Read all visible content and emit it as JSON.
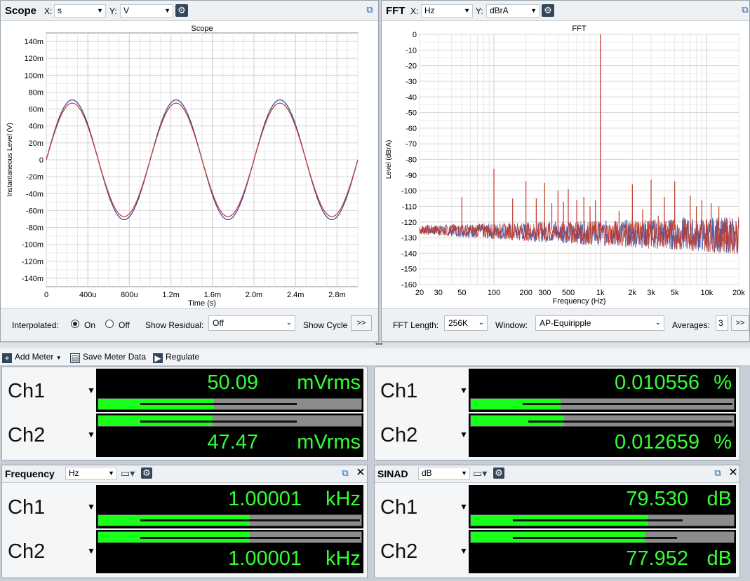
{
  "scope": {
    "title": "Scope",
    "x_label": "X:",
    "x_unit": "s",
    "y_label": "Y:",
    "y_unit": "V",
    "chart_title": "Scope",
    "interpolated_label": "Interpolated:",
    "on_label": "On",
    "off_label": "Off",
    "show_residual_label": "Show Residual:",
    "show_residual_value": "Off",
    "show_cycle_label": "Show Cycle",
    "more_label": ">>"
  },
  "fft": {
    "title": "FFT",
    "x_label": "X:",
    "x_unit": "Hz",
    "y_label": "Y:",
    "y_unit": "dBrA",
    "chart_title": "FFT",
    "fft_length_label": "FFT Length:",
    "fft_length_value": "256K",
    "window_label": "Window:",
    "window_value": "AP-Equiripple",
    "averages_label": "Averages:",
    "averages_value": "3",
    "more_label": ">>"
  },
  "toolbar": {
    "add_meter": "Add Meter",
    "save_meter_data": "Save Meter Data",
    "regulate": "Regulate"
  },
  "meters": {
    "level": {
      "ch1": {
        "label": "Ch1",
        "value": "50.09",
        "unit": "mVrms",
        "bar": 0.44,
        "peak": 0.76
      },
      "ch2": {
        "label": "Ch2",
        "value": "47.47",
        "unit": "mVrms",
        "bar": 0.435,
        "peak": 0.76
      }
    },
    "thdn": {
      "ch1": {
        "label": "Ch1",
        "value": "0.010556",
        "unit": "%",
        "bar": 0.34,
        "peak": 1.0
      },
      "ch2": {
        "label": "Ch2",
        "value": "0.012659",
        "unit": "%",
        "bar": 0.355,
        "peak": 1.0
      }
    },
    "frequency": {
      "title": "Frequency",
      "unit_select": "Hz",
      "ch1": {
        "label": "Ch1",
        "value": "1.00001",
        "unit": "kHz",
        "bar": 0.575,
        "peak": 1.0
      },
      "ch2": {
        "label": "Ch2",
        "value": "1.00001",
        "unit": "kHz",
        "bar": 0.575,
        "peak": 1.0
      }
    },
    "sinad": {
      "title": "SINAD",
      "unit_select": "dB",
      "ch1": {
        "label": "Ch1",
        "value": "79.530",
        "unit": "dB",
        "bar": 0.675,
        "peak": 0.81
      },
      "ch2": {
        "label": "Ch2",
        "value": "77.952",
        "unit": "dB",
        "bar": 0.66,
        "peak": 0.79
      }
    }
  },
  "colors": {
    "ch1": "#2c3e9b",
    "ch2": "#c0392b",
    "meter_green": "#33ff33"
  },
  "chart_data": [
    {
      "type": "line",
      "title": "Scope",
      "xlabel": "Time (s)",
      "ylabel": "Instantaneous Level (V)",
      "xlim": [
        0,
        0.003
      ],
      "ylim": [
        -0.15,
        0.15
      ],
      "x_ticks": [
        0,
        0.0004,
        0.0008,
        0.0012,
        0.0016,
        0.002,
        0.0024,
        0.0028
      ],
      "x_tick_labels": [
        "0",
        "400u",
        "800u",
        "1.2m",
        "1.6m",
        "2.0m",
        "2.4m",
        "2.8m"
      ],
      "y_ticks": [
        0.14,
        0.12,
        0.1,
        0.08,
        0.06,
        0.04,
        0.02,
        0,
        -0.02,
        -0.04,
        -0.06,
        -0.08,
        -0.1,
        -0.12,
        -0.14
      ],
      "y_tick_labels": [
        "140m",
        "120m",
        "100m",
        "80m",
        "60m",
        "40m",
        "20m",
        "0",
        "-20m",
        "-40m",
        "-60m",
        "-80m",
        "-100m",
        "-120m",
        "-140m"
      ],
      "series": [
        {
          "frequency_hz": 1000,
          "amplitude_v": 0.0708,
          "color": "#2c3e9b"
        },
        {
          "frequency_hz": 1000,
          "amplitude_v": 0.0671,
          "color": "#c0392b"
        }
      ],
      "grid": true
    },
    {
      "type": "line",
      "title": "FFT",
      "xlabel": "Frequency (Hz)",
      "ylabel": "Level (dBrA)",
      "xscale": "log",
      "xlim": [
        20,
        20000
      ],
      "ylim": [
        -160,
        0
      ],
      "x_ticks": [
        20,
        30,
        50,
        100,
        200,
        300,
        500,
        1000,
        2000,
        3000,
        5000,
        10000,
        20000
      ],
      "x_tick_labels": [
        "20",
        "30",
        "50",
        "100",
        "200",
        "300",
        "500",
        "1k",
        "2k",
        "3k",
        "5k",
        "10k",
        "20k"
      ],
      "y_ticks": [
        0,
        -10,
        -20,
        -30,
        -40,
        -50,
        -60,
        -70,
        -80,
        -90,
        -100,
        -110,
        -120,
        -130,
        -140,
        -150,
        -160
      ],
      "y_tick_labels": [
        "0",
        "-10",
        "-20",
        "-30",
        "-40",
        "-50",
        "-60",
        "-70",
        "-80",
        "-90",
        "-100",
        "-110",
        "-120",
        "-130",
        "-140",
        "-150",
        "-160"
      ],
      "noise_floor_db": -125,
      "peaks": [
        {
          "x": 50,
          "y": -104
        },
        {
          "x": 100,
          "y": -86
        },
        {
          "x": 150,
          "y": -105
        },
        {
          "x": 200,
          "y": -94
        },
        {
          "x": 250,
          "y": -105
        },
        {
          "x": 300,
          "y": -95
        },
        {
          "x": 350,
          "y": -108
        },
        {
          "x": 400,
          "y": -100
        },
        {
          "x": 450,
          "y": -107
        },
        {
          "x": 500,
          "y": -99
        },
        {
          "x": 600,
          "y": -106
        },
        {
          "x": 700,
          "y": -104
        },
        {
          "x": 800,
          "y": -110
        },
        {
          "x": 900,
          "y": -106
        },
        {
          "x": 1000,
          "y": 0
        },
        {
          "x": 1500,
          "y": -113
        },
        {
          "x": 2000,
          "y": -96
        },
        {
          "x": 2500,
          "y": -112
        },
        {
          "x": 3000,
          "y": -93
        },
        {
          "x": 3500,
          "y": -116
        },
        {
          "x": 4000,
          "y": -104
        },
        {
          "x": 5000,
          "y": -94
        },
        {
          "x": 6000,
          "y": -117
        },
        {
          "x": 7000,
          "y": -103
        },
        {
          "x": 8000,
          "y": -110
        },
        {
          "x": 9000,
          "y": -106
        },
        {
          "x": 10000,
          "y": -118
        },
        {
          "x": 11000,
          "y": -108
        },
        {
          "x": 13000,
          "y": -110
        }
      ],
      "grid": true
    }
  ]
}
